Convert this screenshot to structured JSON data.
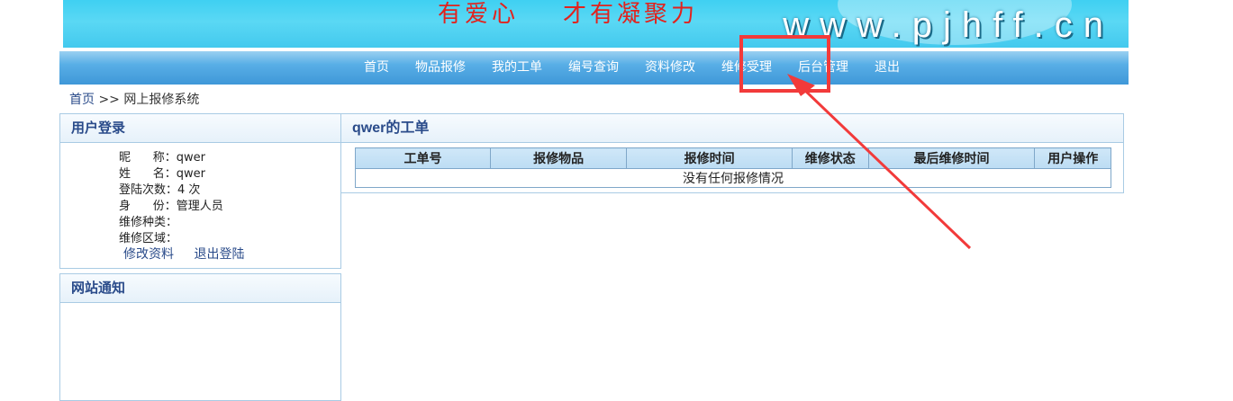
{
  "banner": {
    "slogan": "有爱心    才有凝聚力",
    "url": "www.pjhff.cn"
  },
  "nav": {
    "items": [
      {
        "label": "首页"
      },
      {
        "label": "物品报修"
      },
      {
        "label": "我的工单"
      },
      {
        "label": "编号查询"
      },
      {
        "label": "资料修改"
      },
      {
        "label": "维修受理"
      },
      {
        "label": "后台管理"
      },
      {
        "label": "退出"
      }
    ]
  },
  "breadcrumb": {
    "home": "首页",
    "separator": " >> ",
    "current": "网上报修系统"
  },
  "login_panel": {
    "title": "用户登录",
    "rows": [
      {
        "label": "昵      称：",
        "value": "qwer"
      },
      {
        "label": "姓      名：",
        "value": "qwer"
      },
      {
        "label": "登陆次数：",
        "value": "4 次"
      },
      {
        "label": "身      份：",
        "value": "管理人员"
      },
      {
        "label": "维修种类：",
        "value": ""
      },
      {
        "label": "维修区域：",
        "value": ""
      }
    ],
    "edit_link": "修改资料",
    "logout_link": "退出登陆"
  },
  "notice_panel": {
    "title": "网站通知"
  },
  "orders": {
    "title": "qwer的工单",
    "columns": [
      "工单号",
      "报修物品",
      "报修时间",
      "维修状态",
      "最后维修时间",
      "用户操作"
    ],
    "empty_text": "没有任何报修情况"
  },
  "colors": {
    "highlight": "#f23a3a",
    "nav_bg": "#4fa3de",
    "link": "#2a4b8a"
  }
}
